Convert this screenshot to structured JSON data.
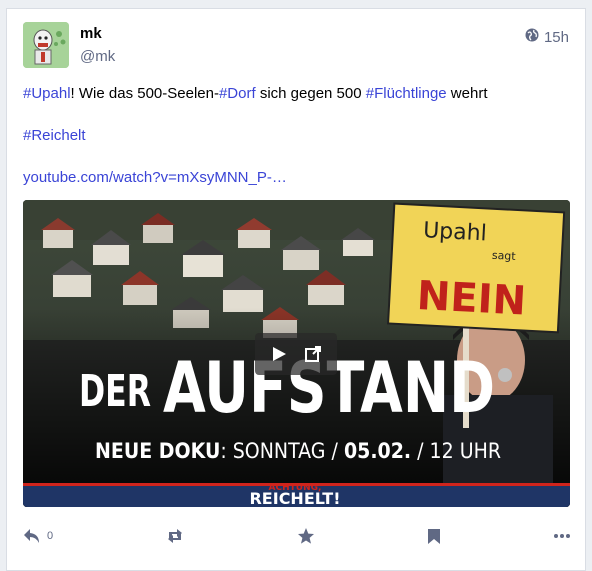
{
  "status": {
    "display_name": "mk",
    "username": "@mk",
    "time": "15h",
    "content": {
      "line1": {
        "tag1": "#Upahl",
        "text1": "! Wie das 500-Seelen-",
        "tag2": "#Dorf",
        "text2": " sich gegen 500 ",
        "tag3": "#Flüchtlinge",
        "text3": " wehrt"
      },
      "tag4": "#Reichelt",
      "link": "youtube.com/watch?v=mXsyMNN_P-…"
    },
    "media": {
      "sign_line1": "Upahl",
      "sign_line2": "sagt",
      "sign_line3": "NEIN",
      "title_der": "DER",
      "title_aufstand": "AUFSTAND",
      "subtitle_bold": "NEUE DOKU",
      "subtitle_rest": ": SONNTAG / ",
      "subtitle_date": "05.02.",
      "subtitle_time": " / 12 UHR",
      "banner_top": "ACHTUNG,",
      "banner_main": "REICHELT!"
    },
    "actions": {
      "reply_count": "0"
    }
  }
}
